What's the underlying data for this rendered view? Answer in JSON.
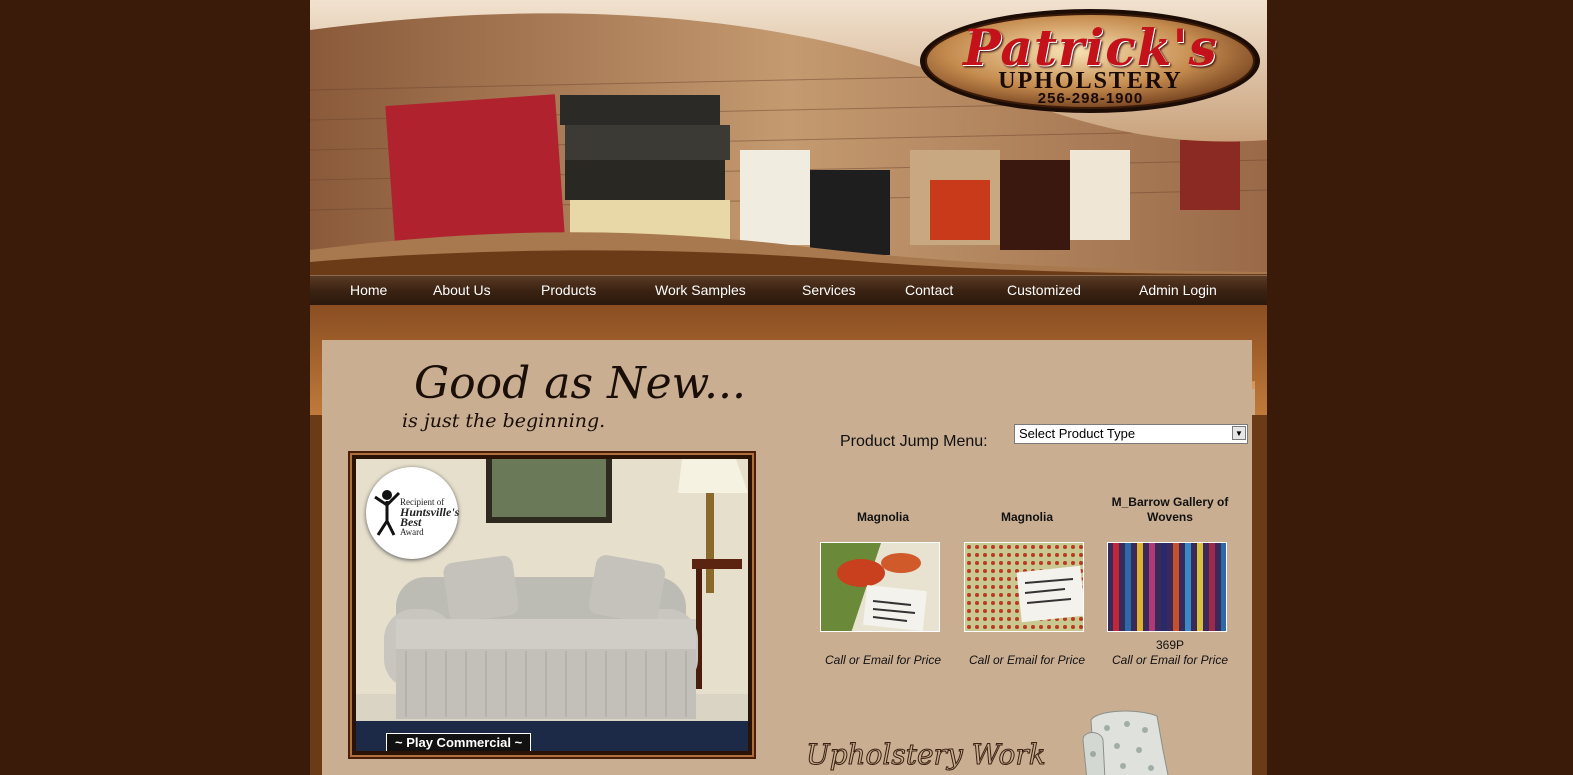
{
  "logo": {
    "name": "Patrick's",
    "subtitle": "UPHOLSTERY",
    "phone": "256-298-1900"
  },
  "nav": {
    "items": [
      {
        "label": "Home"
      },
      {
        "label": "About Us"
      },
      {
        "label": "Products"
      },
      {
        "label": "Work Samples"
      },
      {
        "label": "Services"
      },
      {
        "label": "Contact"
      },
      {
        "label": "Customized"
      },
      {
        "label": "Admin Login"
      }
    ]
  },
  "tagline": {
    "main": "Good as New...",
    "sub": "is just the beginning."
  },
  "video": {
    "badge_line1": "Recipient of",
    "badge_line2": "Huntsville's",
    "badge_line3": "Best",
    "badge_line4": "Award",
    "play_label": "~ Play Commercial ~"
  },
  "jump_menu": {
    "label": "Product Jump Menu:",
    "selected": "Select Product Type"
  },
  "products": [
    {
      "title": "Magnolia",
      "code": "",
      "price": "Call or Email for Price",
      "icon": "fabric-swatch-floral"
    },
    {
      "title": "Magnolia",
      "code": "",
      "price": "Call or Email for Price",
      "icon": "fabric-swatch-dotted"
    },
    {
      "title": "M_Barrow Gallery of Wovens",
      "code": "369P",
      "price": "Call or Email for Price",
      "icon": "fabric-swatch-striped"
    }
  ],
  "section_title": "Upholstery Work",
  "colors": {
    "page_bg": "#3a1a08",
    "frame": "#6b3a17",
    "content_bg": "#c9ae92",
    "logo_red": "#c4121a"
  }
}
